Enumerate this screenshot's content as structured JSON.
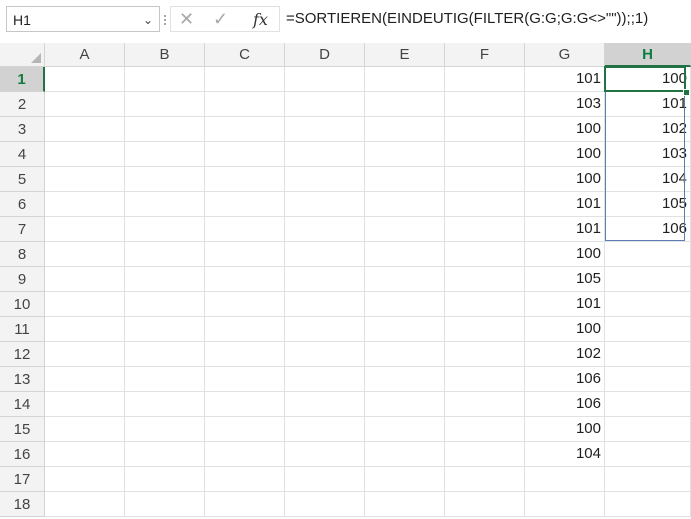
{
  "name_box": {
    "value": "H1"
  },
  "formula_bar": {
    "cancel_icon": "x-icon",
    "enter_icon": "check-icon",
    "fx_label": "fx",
    "formula": "=SORTIEREN(EINDEUTIG(FILTER(G:G;G:G<>\"\"));;1)"
  },
  "columns": [
    "A",
    "B",
    "C",
    "D",
    "E",
    "F",
    "G",
    "H"
  ],
  "rows": [
    "1",
    "2",
    "3",
    "4",
    "5",
    "6",
    "7",
    "8",
    "9",
    "10",
    "11",
    "12",
    "13",
    "14",
    "15",
    "16",
    "17",
    "18"
  ],
  "selected": {
    "column": "H",
    "row": "1"
  },
  "column_g": [
    "101",
    "103",
    "100",
    "100",
    "100",
    "101",
    "101",
    "100",
    "105",
    "101",
    "100",
    "102",
    "106",
    "106",
    "100",
    "104",
    "",
    ""
  ],
  "column_h": [
    "100",
    "101",
    "102",
    "103",
    "104",
    "105",
    "106",
    "",
    "",
    "",
    "",
    "",
    "",
    "",
    "",
    "",
    "",
    ""
  ],
  "colors": {
    "accent": "#217346",
    "spill_border": "#5b7db1"
  }
}
